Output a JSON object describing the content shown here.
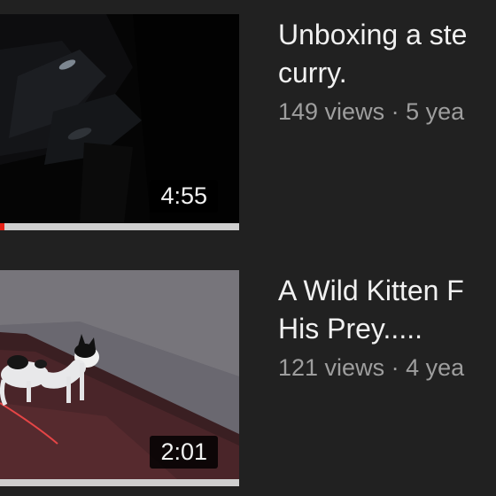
{
  "videos": [
    {
      "title_line1": "Unboxing a ste",
      "title_line2": "curry.",
      "views": "149 views",
      "separator": "·",
      "age": "5 yea",
      "duration": "4:55",
      "watched_fraction": 0.018
    },
    {
      "title_line1": "A Wild Kitten F",
      "title_line2": "His Prey.....",
      "views": "121 views",
      "separator": "·",
      "age": "4 yea",
      "duration": "2:01",
      "watched_fraction": 0
    }
  ],
  "colors": {
    "background": "#212121",
    "title": "#f1f1f1",
    "stats": "#9e9e9e",
    "progress_played": "#e62117",
    "progress_track": "#cfcfcf"
  }
}
